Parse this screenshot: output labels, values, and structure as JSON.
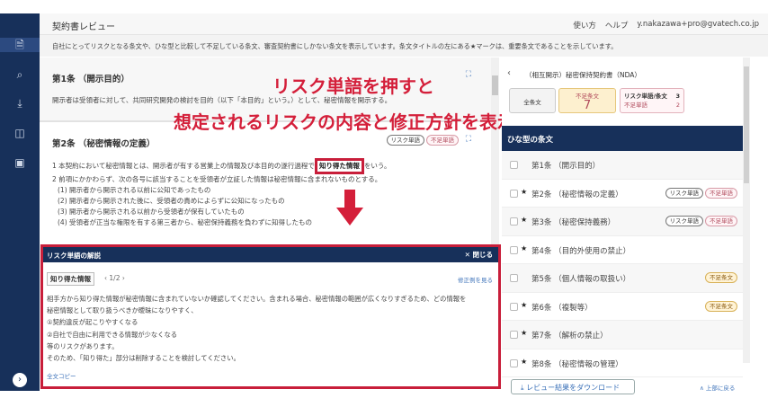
{
  "header": {
    "title": "契約書レビュー",
    "how_to": "使い方",
    "help": "ヘルプ",
    "user": "y.nakazawa+pro@gvatech.co.jp"
  },
  "notice": "自社にとってリスクとなる条文や、ひな型と比較して不足している条文、審査契約書にしかない条文を表示しています。条文タイトルの左にある★マークは、重要条文であることを示しています。",
  "articles": [
    {
      "title": "第1条 （開示目的）",
      "body": "開示者は受領者に対して、共同研究開発の検討を目的（以下「本目的」という。）として、秘密情報を開示する。"
    },
    {
      "title": "第2条 （秘密情報の定義）",
      "tag_risk": "リスク単語",
      "tag_short": "不足単語",
      "line1_pre": "1 本契約において秘密情報とは、開示者が有する営業上の情報及び本目的の遂行過程で",
      "line1_hl": "知り得た情報",
      "line1_post": "をいう。",
      "line2": "2 前項にかかわらず、次の各号に該当することを受領者が立証した情報は秘密情報に含まれないものとする。",
      "items": [
        "(1) 開示者から開示される以前に公知であったもの",
        "(2) 開示者から開示された後に、受領者の責めによらずに公知になったもの",
        "(3) 開示者から開示される以前から受領者が保有していたもの",
        "(4) 受領者が正当な権限を有する第三者から、秘密保持義務を負わずに知得したもの"
      ]
    }
  ],
  "overlay": {
    "line1": "リスク単語を押すと",
    "line2": "想定されるリスクの内容と修正方針を表示"
  },
  "panel": {
    "title": "リスク単語の解説",
    "close": "閉じる",
    "word": "知り得た情報",
    "pager": "1/2",
    "fix_link": "修正例を見る",
    "lines": [
      "相手方から知り得た情報が秘密情報に含まれていないか確認してください。含まれる場合、秘密情報の範囲が広くなりすぎるため、どの情報を",
      "秘密情報として取り扱うべきか曖昧になりやすく、",
      "①契約違反が起こりやすくなる",
      "②自社で自由に利用できる情報が少なくなる",
      "等のリスクがあります。",
      "そのため、「知り得た」部分は削除することを検討してください。"
    ],
    "copy": "全文コピー"
  },
  "right": {
    "doc_title": "（相互開示）秘密保持契約書（NDA）",
    "all_label": "全条文",
    "lack_label": "不足条文",
    "lack_count": "7",
    "risk_label": "リスク単語/条文",
    "risk_count": "3",
    "short_label": "不足単語",
    "short_count": "2",
    "section": "ひな型の条文",
    "items": [
      {
        "label": "第1条 （開示目的）",
        "star": "",
        "tags": []
      },
      {
        "label": "第2条 （秘密情報の定義）",
        "star": "★",
        "tags": [
          "リスク単語",
          "不足単語"
        ]
      },
      {
        "label": "第3条 （秘密保持義務）",
        "star": "★",
        "tags": [
          "リスク単語",
          "不足単語"
        ]
      },
      {
        "label": "第4条 （目的外使用の禁止）",
        "star": "★",
        "tags": []
      },
      {
        "label": "第5条 （個人情報の取扱い）",
        "star": "",
        "tags": [
          "不足条文"
        ]
      },
      {
        "label": "第6条 （複製等）",
        "star": "★",
        "tags": [
          "不足条文"
        ]
      },
      {
        "label": "第7条 （解析の禁止）",
        "star": "★",
        "tags": []
      },
      {
        "label": "第8条 （秘密情報の管理）",
        "star": "★",
        "tags": []
      }
    ],
    "download": "レビュー結果をダウンロード",
    "back_top": "上部に戻る"
  }
}
